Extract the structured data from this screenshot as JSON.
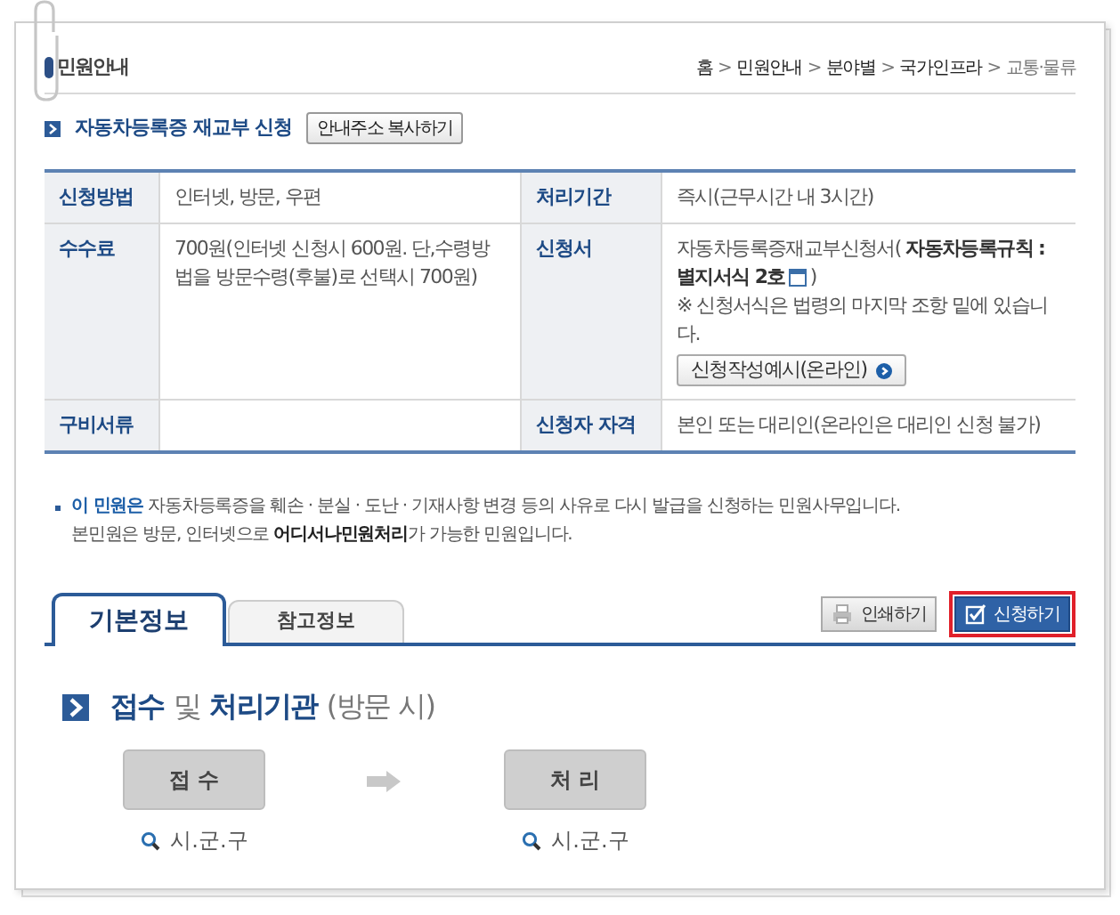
{
  "header": {
    "title": "민원안내",
    "breadcrumb": [
      {
        "label": "홈",
        "current": false
      },
      {
        "label": "민원안내",
        "current": false
      },
      {
        "label": "분야별",
        "current": false
      },
      {
        "label": "국가인프라",
        "current": false
      },
      {
        "label": "교통·물류",
        "current": true
      }
    ],
    "separator": ">"
  },
  "service": {
    "title": "자동차등록증 재교부 신청",
    "copy_button": "안내주소 복사하기"
  },
  "table": {
    "rows": [
      {
        "cells": [
          {
            "label": "신청방법",
            "value": "인터넷, 방문, 우편"
          },
          {
            "label": "처리기간",
            "value": "즉시(근무시간 내 3시간)"
          }
        ]
      },
      {
        "cells": [
          {
            "label": "수수료",
            "value": "700원(인터넷 신청시 600원. 단,수령방법을 방문수령(후불)로 선택시 700원)"
          },
          {
            "label": "신청서",
            "kind": "form",
            "form_name": "자동차등록증재교부신청서( **자동차등록규칙 :**",
            "form_name_end": "별지서식 2호",
            "form_close": ")",
            "note": "※ 신청서식은 법령의 마지막 조항 밑에 있습니다.",
            "button": "신청작성예시(온라인)"
          }
        ]
      },
      {
        "cells": [
          {
            "label": "구비서류"
          },
          {
            "label": "신청자 자격",
            "value": "본인 또는 대리인(온라인은 대리인 신청 불가)"
          }
        ]
      }
    ]
  },
  "notice": {
    "lead": "이 민원은",
    "line1": "자동차등록증을 훼손 · 분실 · 도난 · 기재사항 변경 등의 사유로 다시 발급을 신청하는 민원사무입니다.",
    "line2": "본민원은 방문, 인터넷으로 **어디서나민원처리**가 가능한 민원입니다."
  },
  "tabs": [
    {
      "label": "기본정보",
      "selected": true
    },
    {
      "label": "참고정보",
      "selected": false
    }
  ],
  "actions": [
    {
      "label": "인쇄하기",
      "kind": "print",
      "highlighted": false
    },
    {
      "label": "신청하기",
      "kind": "apply",
      "highlighted": true
    }
  ],
  "section": {
    "title": [
      {
        "text": "접수",
        "emphasis": true
      },
      {
        "text": "및",
        "emphasis": false
      },
      {
        "text": "처리기관",
        "emphasis": true
      },
      {
        "text": "(방문 시)",
        "emphasis": false
      }
    ],
    "steps": [
      {
        "label": "접 수",
        "office": "시.군.구"
      },
      {
        "label": "처 리",
        "office": "시.군.구"
      }
    ]
  }
}
